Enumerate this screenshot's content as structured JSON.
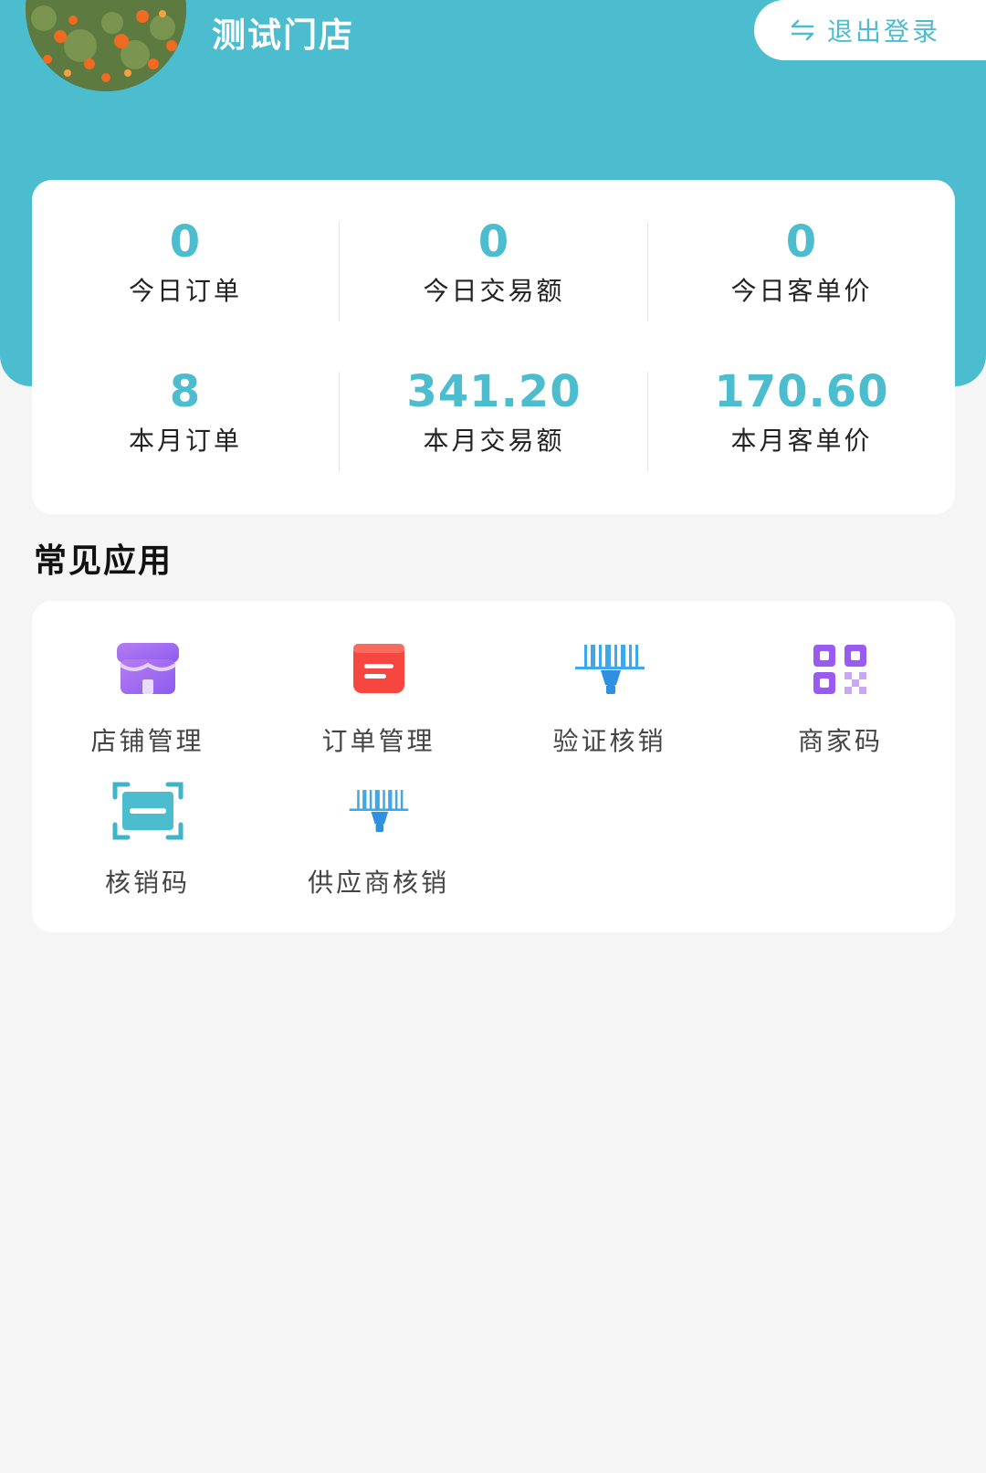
{
  "header": {
    "store_name": "测试门店",
    "logout_label": "退出登录",
    "accent_color": "#4cbccf"
  },
  "stats": [
    {
      "value": "0",
      "label": "今日订单"
    },
    {
      "value": "0",
      "label": "今日交易额"
    },
    {
      "value": "0",
      "label": "今日客单价"
    },
    {
      "value": "8",
      "label": "本月订单"
    },
    {
      "value": "341.20",
      "label": "本月交易额"
    },
    {
      "value": "170.60",
      "label": "本月客单价"
    }
  ],
  "section_title": "常见应用",
  "apps": [
    {
      "label": "店铺管理",
      "icon": "store-icon"
    },
    {
      "label": "订单管理",
      "icon": "order-icon"
    },
    {
      "label": "验证核销",
      "icon": "barcode-scanner-icon"
    },
    {
      "label": "商家码",
      "icon": "qr-code-icon"
    },
    {
      "label": "核销码",
      "icon": "scan-frame-icon"
    },
    {
      "label": "供应商核销",
      "icon": "barcode-scanner-icon"
    }
  ]
}
